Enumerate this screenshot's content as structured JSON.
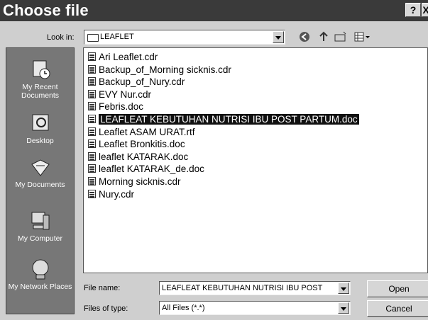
{
  "window": {
    "title": "Choose file",
    "help_label": "?",
    "close_label": "X"
  },
  "look_in": {
    "label": "Look in:",
    "value": "LEAFLET"
  },
  "places": [
    {
      "label": "My Recent Documents",
      "icon": "recent-documents-icon"
    },
    {
      "label": "Desktop",
      "icon": "desktop-icon"
    },
    {
      "label": "My Documents",
      "icon": "my-documents-icon"
    },
    {
      "label": "My Computer",
      "icon": "my-computer-icon"
    },
    {
      "label": "My Network Places",
      "icon": "network-places-icon"
    }
  ],
  "files": [
    {
      "name": "Ari Leaflet.cdr",
      "selected": false
    },
    {
      "name": "Backup_of_Morning sicknis.cdr",
      "selected": false
    },
    {
      "name": "Backup_of_Nury.cdr",
      "selected": false
    },
    {
      "name": "EVY Nur.cdr",
      "selected": false
    },
    {
      "name": "Febris.doc",
      "selected": false
    },
    {
      "name": "LEAFLEAT KEBUTUHAN NUTRISI IBU POST PARTUM.doc",
      "selected": true
    },
    {
      "name": "Leaflet ASAM URAT.rtf",
      "selected": false
    },
    {
      "name": "Leaflet Bronkitis.doc",
      "selected": false
    },
    {
      "name": "leaflet KATARAK.doc",
      "selected": false
    },
    {
      "name": "leaflet KATARAK_de.doc",
      "selected": false
    },
    {
      "name": "Morning sicknis.cdr",
      "selected": false
    },
    {
      "name": "Nury.cdr",
      "selected": false
    }
  ],
  "file_name": {
    "label": "File name:",
    "value": "LEAFLEAT KEBUTUHAN NUTRISI IBU POST"
  },
  "file_type": {
    "label": "Files of type:",
    "value": "All Files (*.*)"
  },
  "buttons": {
    "open": "Open",
    "cancel": "Cancel"
  }
}
